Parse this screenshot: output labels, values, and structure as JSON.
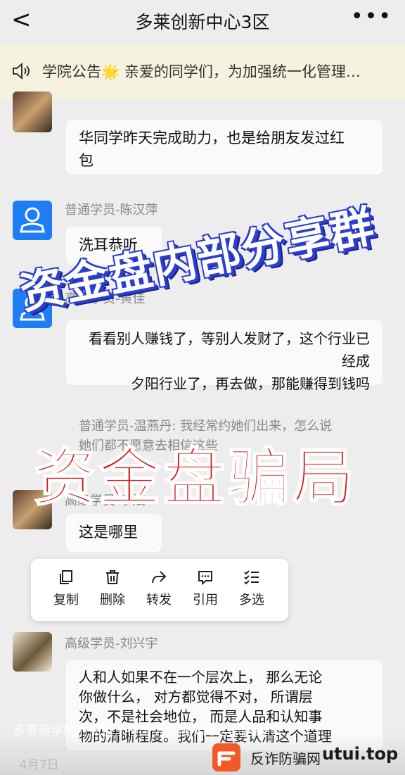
{
  "header": {
    "back_glyph": "<",
    "title": "多莱创新中心3区",
    "more_glyph": "•••"
  },
  "notice": {
    "text": "学院公告🌟 亲爱的同学们，为加强统一化管理…"
  },
  "messages": [
    {
      "sender": "",
      "text": "华同学昨天完成助力，也是给朋友发过红\n包"
    },
    {
      "sender": "普通学员-陈汉萍",
      "text": "洗耳恭听"
    },
    {
      "sender": "高级学员-黄佳",
      "text": "看看别人赚钱了，等别人发财了，这个行业已经成\n夕阳行业了，再去做，那能赚得到钱吗"
    },
    {
      "sender": "普通学员-温燕丹: 我经常约她们出来，怎么说\n她们都不愿意去相信这些",
      "text": ""
    },
    {
      "sender": "高级学员-李斌",
      "text": "这是哪里"
    },
    {
      "sender": "高级学员-刘兴宇",
      "text": "人和人如果不在一个层次上， 那么无论\n你做什么， 对方都觉得不对， 所谓层\n次，不是社会地位， 而是人品和认知事\n物的清晰程度。我们一定要认清这个道理"
    }
  ],
  "context_menu": {
    "items": [
      {
        "label": "复制",
        "icon": "copy-icon"
      },
      {
        "label": "删除",
        "icon": "trash-icon"
      },
      {
        "label": "转发",
        "icon": "forward-icon"
      },
      {
        "label": "引用",
        "icon": "quote-icon"
      },
      {
        "label": "多选",
        "icon": "multiselect-icon"
      }
    ]
  },
  "watermarks": {
    "banner_top": "资金盘内部分享群",
    "banner_bottom": "资金盘骗局"
  },
  "footer": {
    "ticker": "多莱商学院对加盟…在国努力触发的人都能获得…",
    "date": "4月7日"
  },
  "brand": {
    "name": "反诈防骗网",
    "domain": "utui.top"
  },
  "colors": {
    "accent_blue": "#1f7ef5",
    "watermark_red": "#e01818",
    "watermark_blue": "#2c3fcf",
    "brand_orange": "#f05a28"
  }
}
